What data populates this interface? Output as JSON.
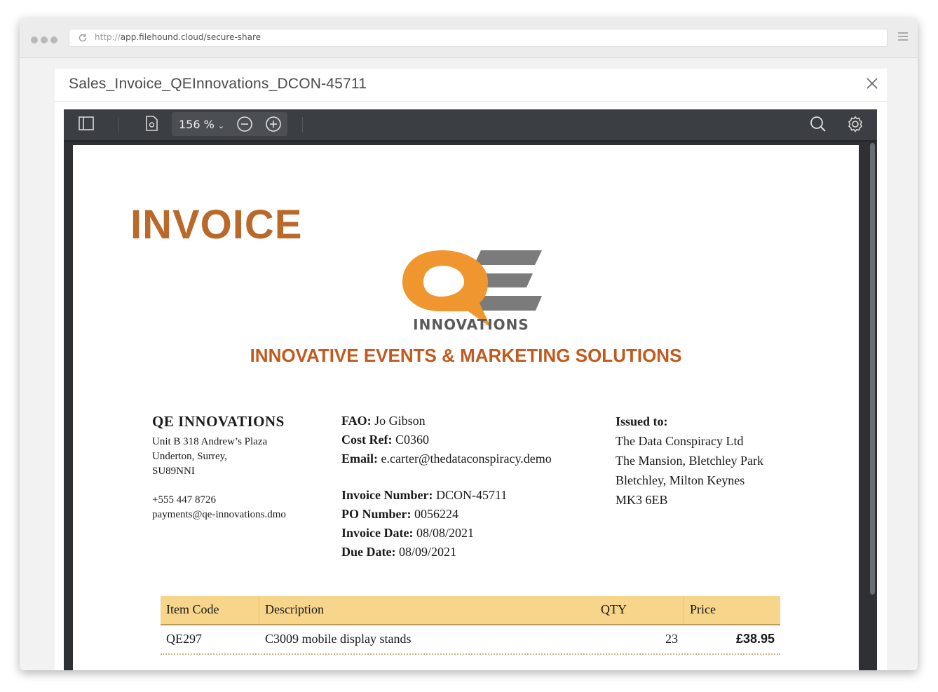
{
  "browser": {
    "url_protocol": "http://",
    "url_path": "app.filehound.cloud/secure-share"
  },
  "modal": {
    "title": "Sales_Invoice_QEInnovations_DCON-45711"
  },
  "toolbar": {
    "zoom": "156 %"
  },
  "invoice": {
    "heading": "INVOICE",
    "logo_text": "INNOVATIONS",
    "tagline": "INNOVATIVE EVENTS & MARKETING SOLUTIONS",
    "company": {
      "name": "QE INNOVATIONS",
      "address1": "Unit B 318 Andrew’s Plaza",
      "address2": "Underton, Surrey,",
      "postcode": "SU89NNI",
      "phone": "+555 447 8726",
      "email": "payments@qe-innovations.dmo"
    },
    "contact": {
      "fao_label": "FAO:",
      "fao_value": "Jo Gibson",
      "costref_label": "Cost Ref:",
      "costref_value": "C0360",
      "email_label": "Email:",
      "email_value": "e.carter@thedataconspiracy.demo"
    },
    "details": {
      "number_label": "Invoice Number:",
      "number_value": "DCON-45711",
      "po_label": "PO Number:",
      "po_value": "0056224",
      "date_label": "Invoice Date:",
      "date_value": "08/08/2021",
      "due_label": "Due Date:",
      "due_value": "08/09/2021"
    },
    "issued_to": {
      "label": "Issued to:",
      "line1": "The Data Conspiracy Ltd",
      "line2": "The Mansion, Bletchley Park",
      "line3": "Bletchley, Milton Keynes",
      "line4": "MK3 6EB"
    },
    "table": {
      "headers": [
        "Item Code",
        "Description",
        "QTY",
        "Price"
      ],
      "rows": [
        {
          "code": "QE297",
          "description": "C3009 mobile display stands",
          "qty": "23",
          "price": "£38.95"
        }
      ]
    }
  }
}
